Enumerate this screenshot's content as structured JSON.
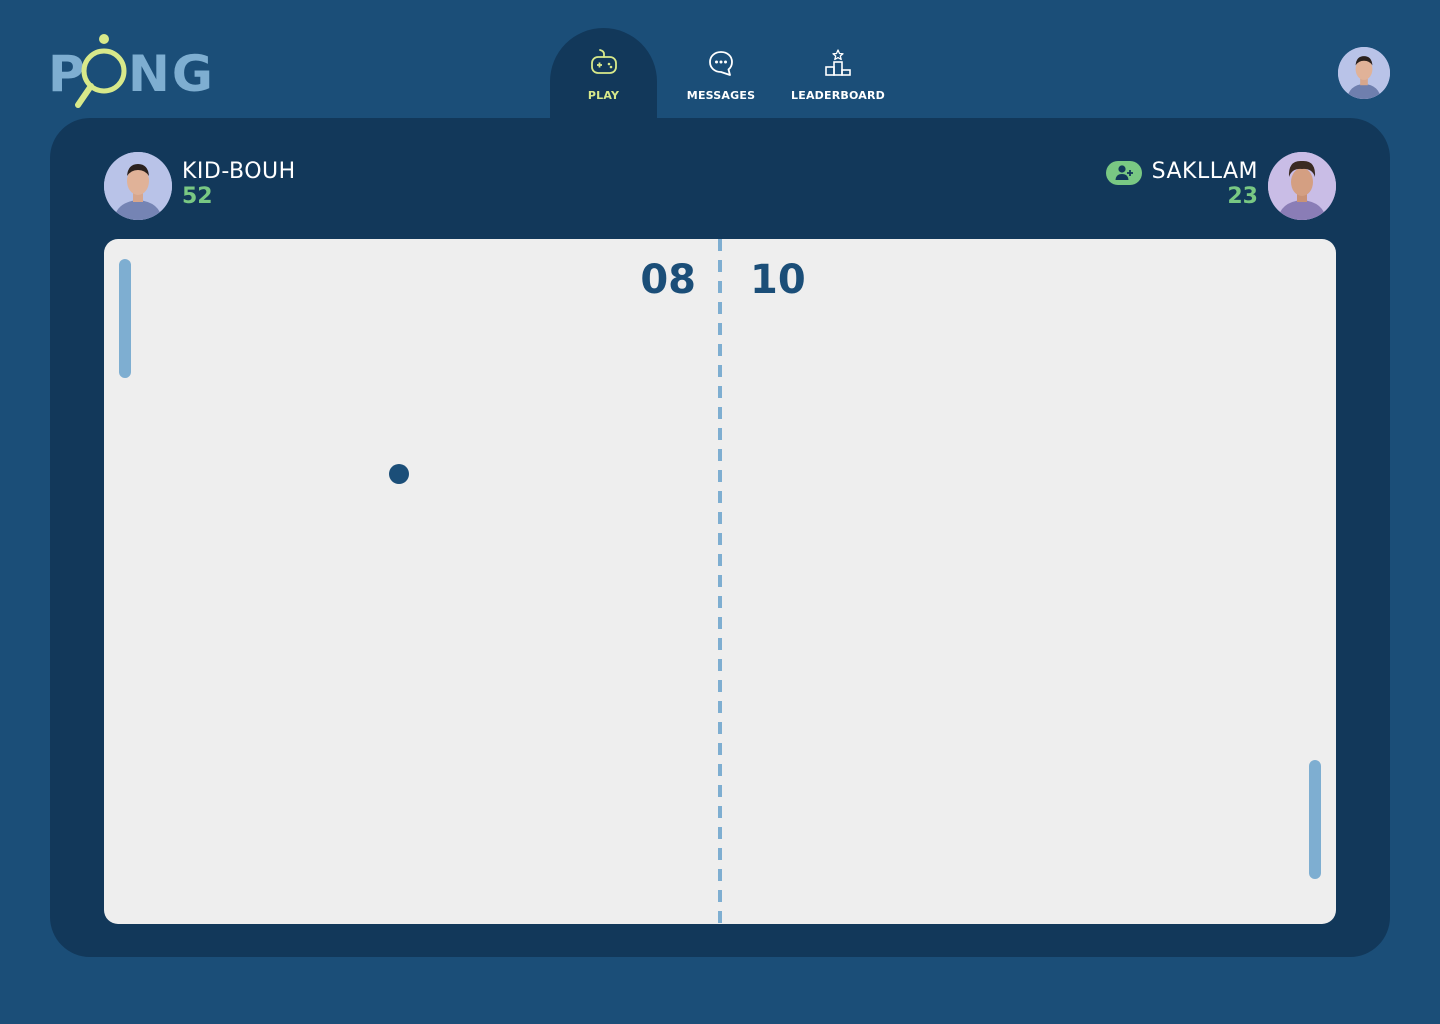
{
  "app": {
    "logo_letters": {
      "p": "P",
      "o": "O",
      "ng": "NG"
    }
  },
  "nav": {
    "items": [
      {
        "label": "PLAY",
        "icon": "gamepad-icon",
        "active": true
      },
      {
        "label": "MESSAGES",
        "icon": "chat-bubble-icon",
        "active": false
      },
      {
        "label": "LEADERBOARD",
        "icon": "podium-icon",
        "active": false
      }
    ]
  },
  "players": {
    "left": {
      "name": "KID-BOUH",
      "level": "52",
      "score": "08"
    },
    "right": {
      "name": "SAKLLAM",
      "level": "23",
      "score": "10"
    }
  },
  "colors": {
    "background": "#1b4e78",
    "panel": "#12385a",
    "board": "#eeeeee",
    "accent_green": "#79c883",
    "accent_yellow": "#d8e98a",
    "paddle": "#7eaed1",
    "ball": "#1b4e78"
  }
}
